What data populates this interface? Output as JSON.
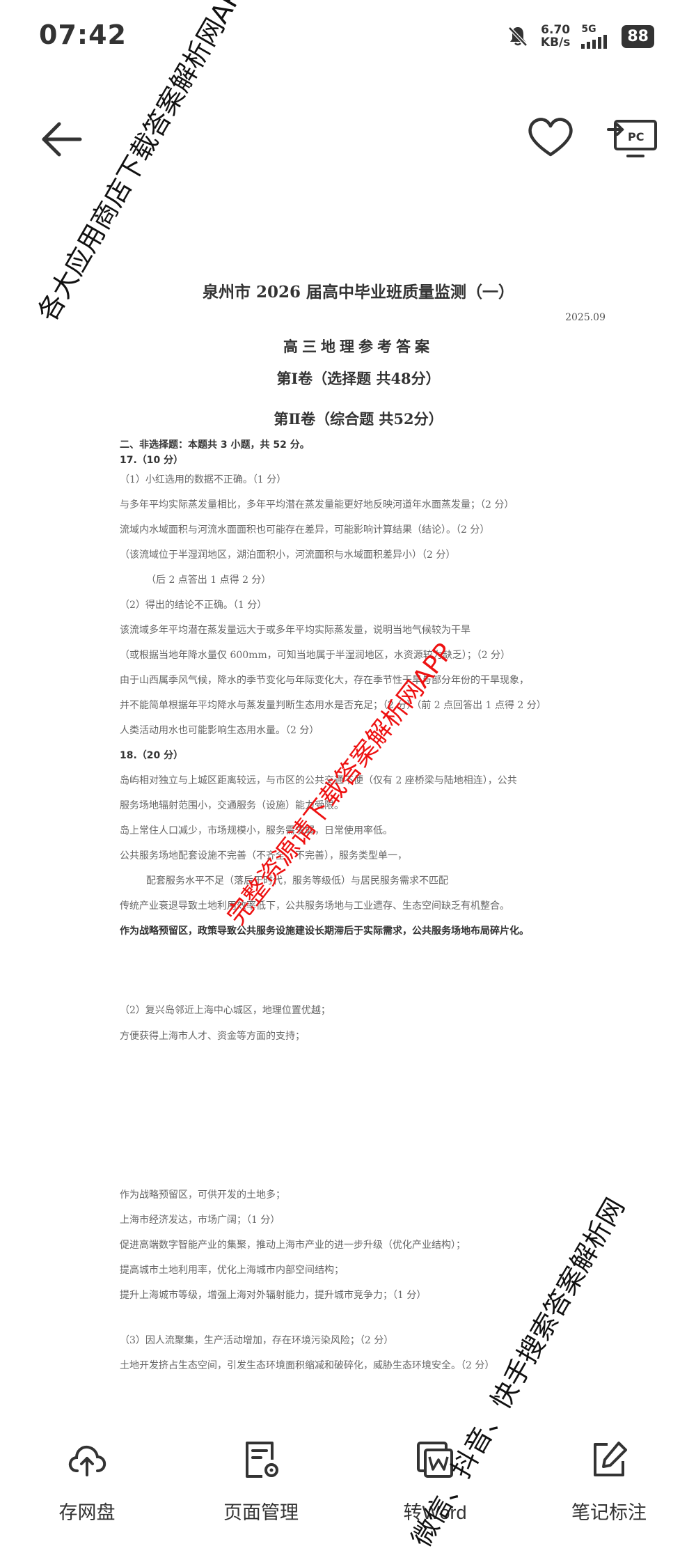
{
  "status": {
    "time": "07:42",
    "speed_value": "6.70",
    "speed_unit": "KB/s",
    "network": "5G",
    "battery": "88"
  },
  "bottom_tabs": [
    {
      "label": "存网盘",
      "icon": "cloud-upload-icon"
    },
    {
      "label": "页面管理",
      "icon": "page-manage-icon"
    },
    {
      "label": "转Word",
      "icon": "word-convert-icon"
    },
    {
      "label": "笔记标注",
      "icon": "edit-note-icon"
    }
  ],
  "document": {
    "title": "泉州市 2026 届高中毕业班质量监测（一）",
    "date": "2025.09",
    "subtitle": "高三地理参考答案",
    "part1": "第Ⅰ卷（选择题 共48分）",
    "part2": "第Ⅱ卷（综合题 共52分）",
    "lines": [
      "二、非选择题：本题共 3 小题，共 52 分。",
      "17.（10 分）",
      "（1）小红选用的数据不正确。（1 分）",
      "与多年平均实际蒸发量相比，多年平均潜在蒸发量能更好地反映河道年水面蒸发量；（2 分）",
      "流域内水域面积与河流水面面积也可能存在差异，可能影响计算结果（结论）。（2 分）",
      "（该流域位于半湿润地区，湖泊面积小，河流面积与水域面积差异小）（2 分）",
      "（后 2 点答出 1 点得 2 分）",
      "（2）得出的结论不正确。（1 分）",
      "该流域多年平均潜在蒸发量远大于或多年平均实际蒸发量，说明当地气候较为干旱",
      "（或根据当地年降水量仅 600mm，可知当地属于半湿润地区，水资源较为缺乏）；（2 分）",
      "由于山西属季风气候，降水的季节变化与年际变化大，存在季节性干旱与部分年份的干旱现象，",
      "并不能简单根据年平均降水与蒸发量判断生态用水是否充足；（2 分）（前 2 点回答出 1 点得 2 分）",
      "人类活动用水也可能影响生态用水量。（2 分）",
      "18.（20 分）",
      "岛屿相对独立与上城区距离较远，与市区的公共交通不便（仅有 2 座桥梁与陆地相连），公共",
      "服务场地辐射范围小，交通服务（设施）能力受限。",
      "岛上常住人口减少，市场规模小，服务需求弱，日常使用率低。",
      "公共服务场地配套设施不完善（不齐全，不完善），服务类型单一，",
      "配套服务水平不足（落后于时代，服务等级低）与居民服务需求不匹配",
      "传统产业衰退导致土地利用效率低下，公共服务场地与工业遗存、生态空间缺乏有机整合。",
      "作为战略预留区，政策导致公共服务设施建设长期滞后于实际需求，公共服务场地布局碎片化。",
      "（2）复兴岛邻近上海中心城区，地理位置优越；",
      "方便获得上海市人才、资金等方面的支持；",
      "作为战略预留区，可供开发的土地多；",
      "上海市经济发达，市场广阔；（1 分）",
      "促进高端数字智能产业的集聚，推动上海市产业的进一步升级（优化产业结构）；",
      "提高城市土地利用率，优化上海城市内部空间结构；",
      "提升上海城市等级，增强上海对外辐射能力，提升城市竞争力；（1 分）",
      "（3）因人流聚集，生产活动增加，存在环境污染风险；（2 分）",
      "土地开发挤占生态空间，引发生态环境面积缩减和破碎化，威胁生态环境安全。（2 分）"
    ]
  },
  "watermarks": {
    "top_left": "各大应用商店下载答案解析网APP",
    "center": "完整资源请下载答案解析网APP",
    "bottom_right": "微信、抖音、快手搜索答案解析网"
  }
}
